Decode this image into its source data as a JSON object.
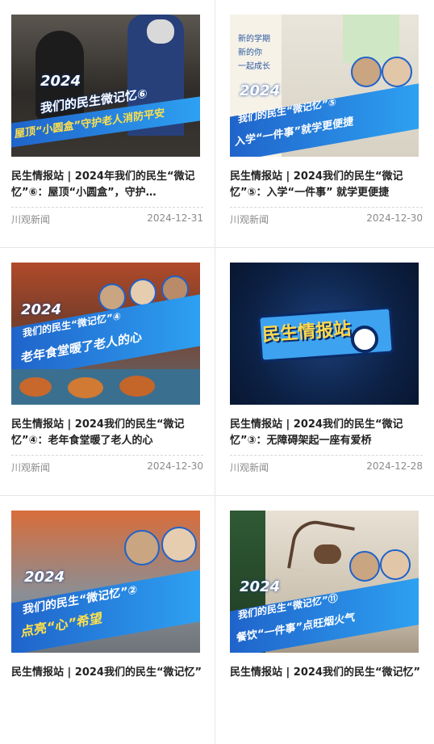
{
  "cards": [
    {
      "title": "民生情报站 | 2024年我们的民生“微记忆”⑥：屋顶“小圆盒”，守护…",
      "source": "川观新闻",
      "date": "2024-12-31",
      "thumb": {
        "year": "2024",
        "line1": "我们的民生微记忆⑥",
        "line2": "屋顶“小圆盒”守护老人消防平安"
      }
    },
    {
      "title": "民生情报站 | 2024我们的民生“微记忆”⑤：入学“一件事” 就学更便捷",
      "source": "川观新闻",
      "date": "2024-12-30",
      "thumb": {
        "year": "2024",
        "line1": "我们的民生“微记忆”⑤",
        "line2": "入学“一件事”就学更便捷",
        "sign1": "新的学期",
        "sign2": "新的你",
        "sign3": "一起成长"
      }
    },
    {
      "title": "民生情报站 | 2024我们的民生“微记忆”④：老年食堂暖了老人的心",
      "source": "川观新闻",
      "date": "2024-12-30",
      "thumb": {
        "year": "2024",
        "line1": "我们的民生“微记忆”④",
        "line2": "老年食堂暖了老人的心"
      }
    },
    {
      "title": "民生情报站 | 2024我们的民生“微记忆”③：无障碍架起一座有爱桥",
      "source": "川观新闻",
      "date": "2024-12-28",
      "thumb": {
        "logo": "民生情报站"
      }
    },
    {
      "title": "民生情报站 | 2024我们的民生“微记忆”",
      "source": "",
      "date": "",
      "thumb": {
        "year": "2024",
        "line1": "我们的民生“微记忆”②",
        "line2": "点亮“心”希望"
      }
    },
    {
      "title": "民生情报站 | 2024我们的民生“微记忆”",
      "source": "",
      "date": "",
      "thumb": {
        "year": "2024",
        "line1": "我们的民生“微记忆”⑪",
        "line2": "餐饮“一件事”点旺烟火气"
      }
    }
  ]
}
